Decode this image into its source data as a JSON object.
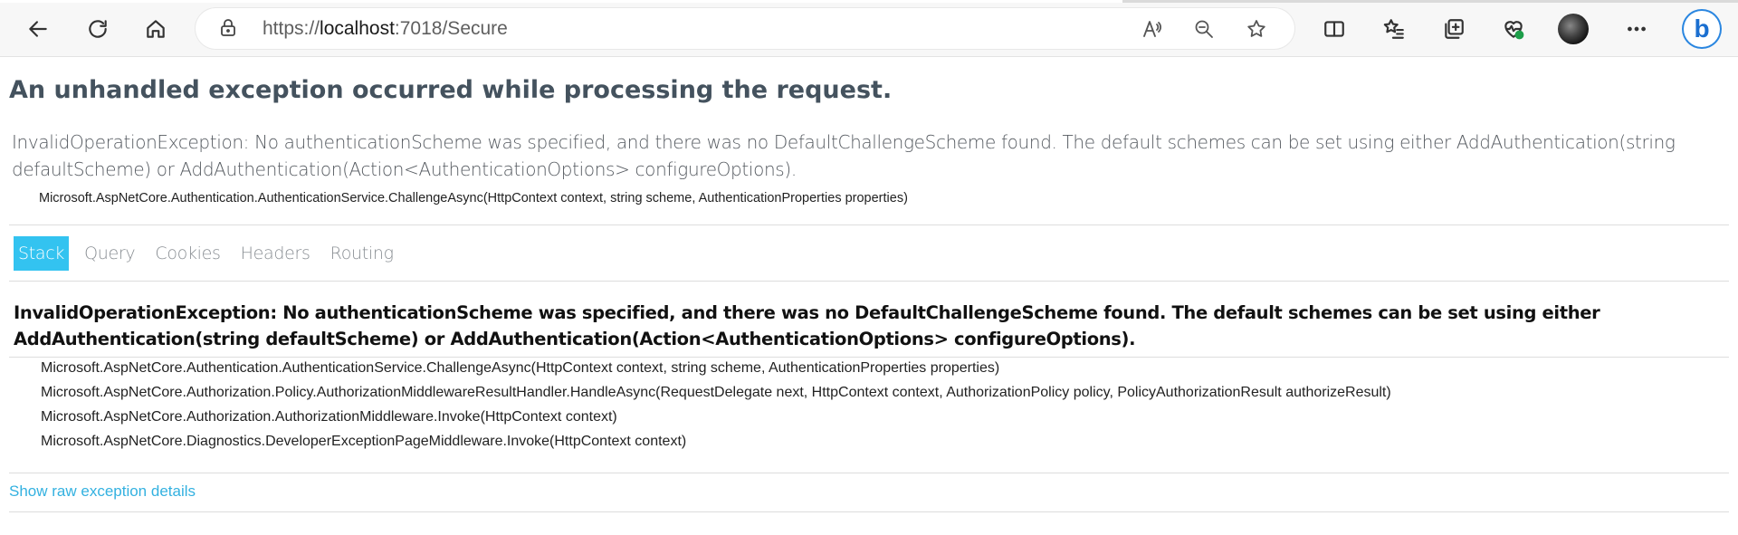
{
  "browser": {
    "url_prefix": "https://",
    "url_host": "localhost",
    "url_path": ":7018/Secure",
    "icons": {
      "back": "arrow-left-icon",
      "refresh": "refresh-icon",
      "home": "home-icon",
      "lock": "lock-icon",
      "read_aloud": "read-aloud-icon",
      "zoom_out": "zoom-out-icon",
      "favorite": "star-icon",
      "split_screen": "split-screen-icon",
      "favorites": "favorites-list-icon",
      "collections": "collections-icon",
      "health": "browser-essentials-icon",
      "profile": "profile-avatar-icon",
      "more": "more-dots-icon",
      "bing": "bing-copilot-icon"
    },
    "bing_glyph": "b"
  },
  "error": {
    "heading": "An unhandled exception occurred while processing the request.",
    "title_line": "InvalidOperationException: No authenticationScheme was specified, and there was no DefaultChallengeScheme found. The default schemes can be set using either AddAuthentication(string defaultScheme) or AddAuthentication(Action<AuthenticationOptions> configureOptions).",
    "location": "Microsoft.AspNetCore.Authentication.AuthenticationService.ChallengeAsync(HttpContext context, string scheme, AuthenticationProperties properties)"
  },
  "tabs": [
    {
      "label": "Stack",
      "selected": true
    },
    {
      "label": "Query",
      "selected": false
    },
    {
      "label": "Cookies",
      "selected": false
    },
    {
      "label": "Headers",
      "selected": false
    },
    {
      "label": "Routing",
      "selected": false
    }
  ],
  "stack": {
    "title": "InvalidOperationException: No authenticationScheme was specified, and there was no DefaultChallengeScheme found. The default schemes can be set using either AddAuthentication(string defaultScheme) or AddAuthentication(Action<AuthenticationOptions> configureOptions).",
    "frames": [
      "Microsoft.AspNetCore.Authentication.AuthenticationService.ChallengeAsync(HttpContext context, string scheme, AuthenticationProperties properties)",
      "Microsoft.AspNetCore.Authorization.Policy.AuthorizationMiddlewareResultHandler.HandleAsync(RequestDelegate next, HttpContext context, AuthorizationPolicy policy, PolicyAuthorizationResult authorizeResult)",
      "Microsoft.AspNetCore.Authorization.AuthorizationMiddleware.Invoke(HttpContext context)",
      "Microsoft.AspNetCore.Diagnostics.DeveloperExceptionPageMiddleware.Invoke(HttpContext context)"
    ],
    "raw_link": "Show raw exception details"
  },
  "colors": {
    "heading": "#44525e",
    "tab_selected_bg": "#33c3f0",
    "link": "#33b1e0"
  }
}
